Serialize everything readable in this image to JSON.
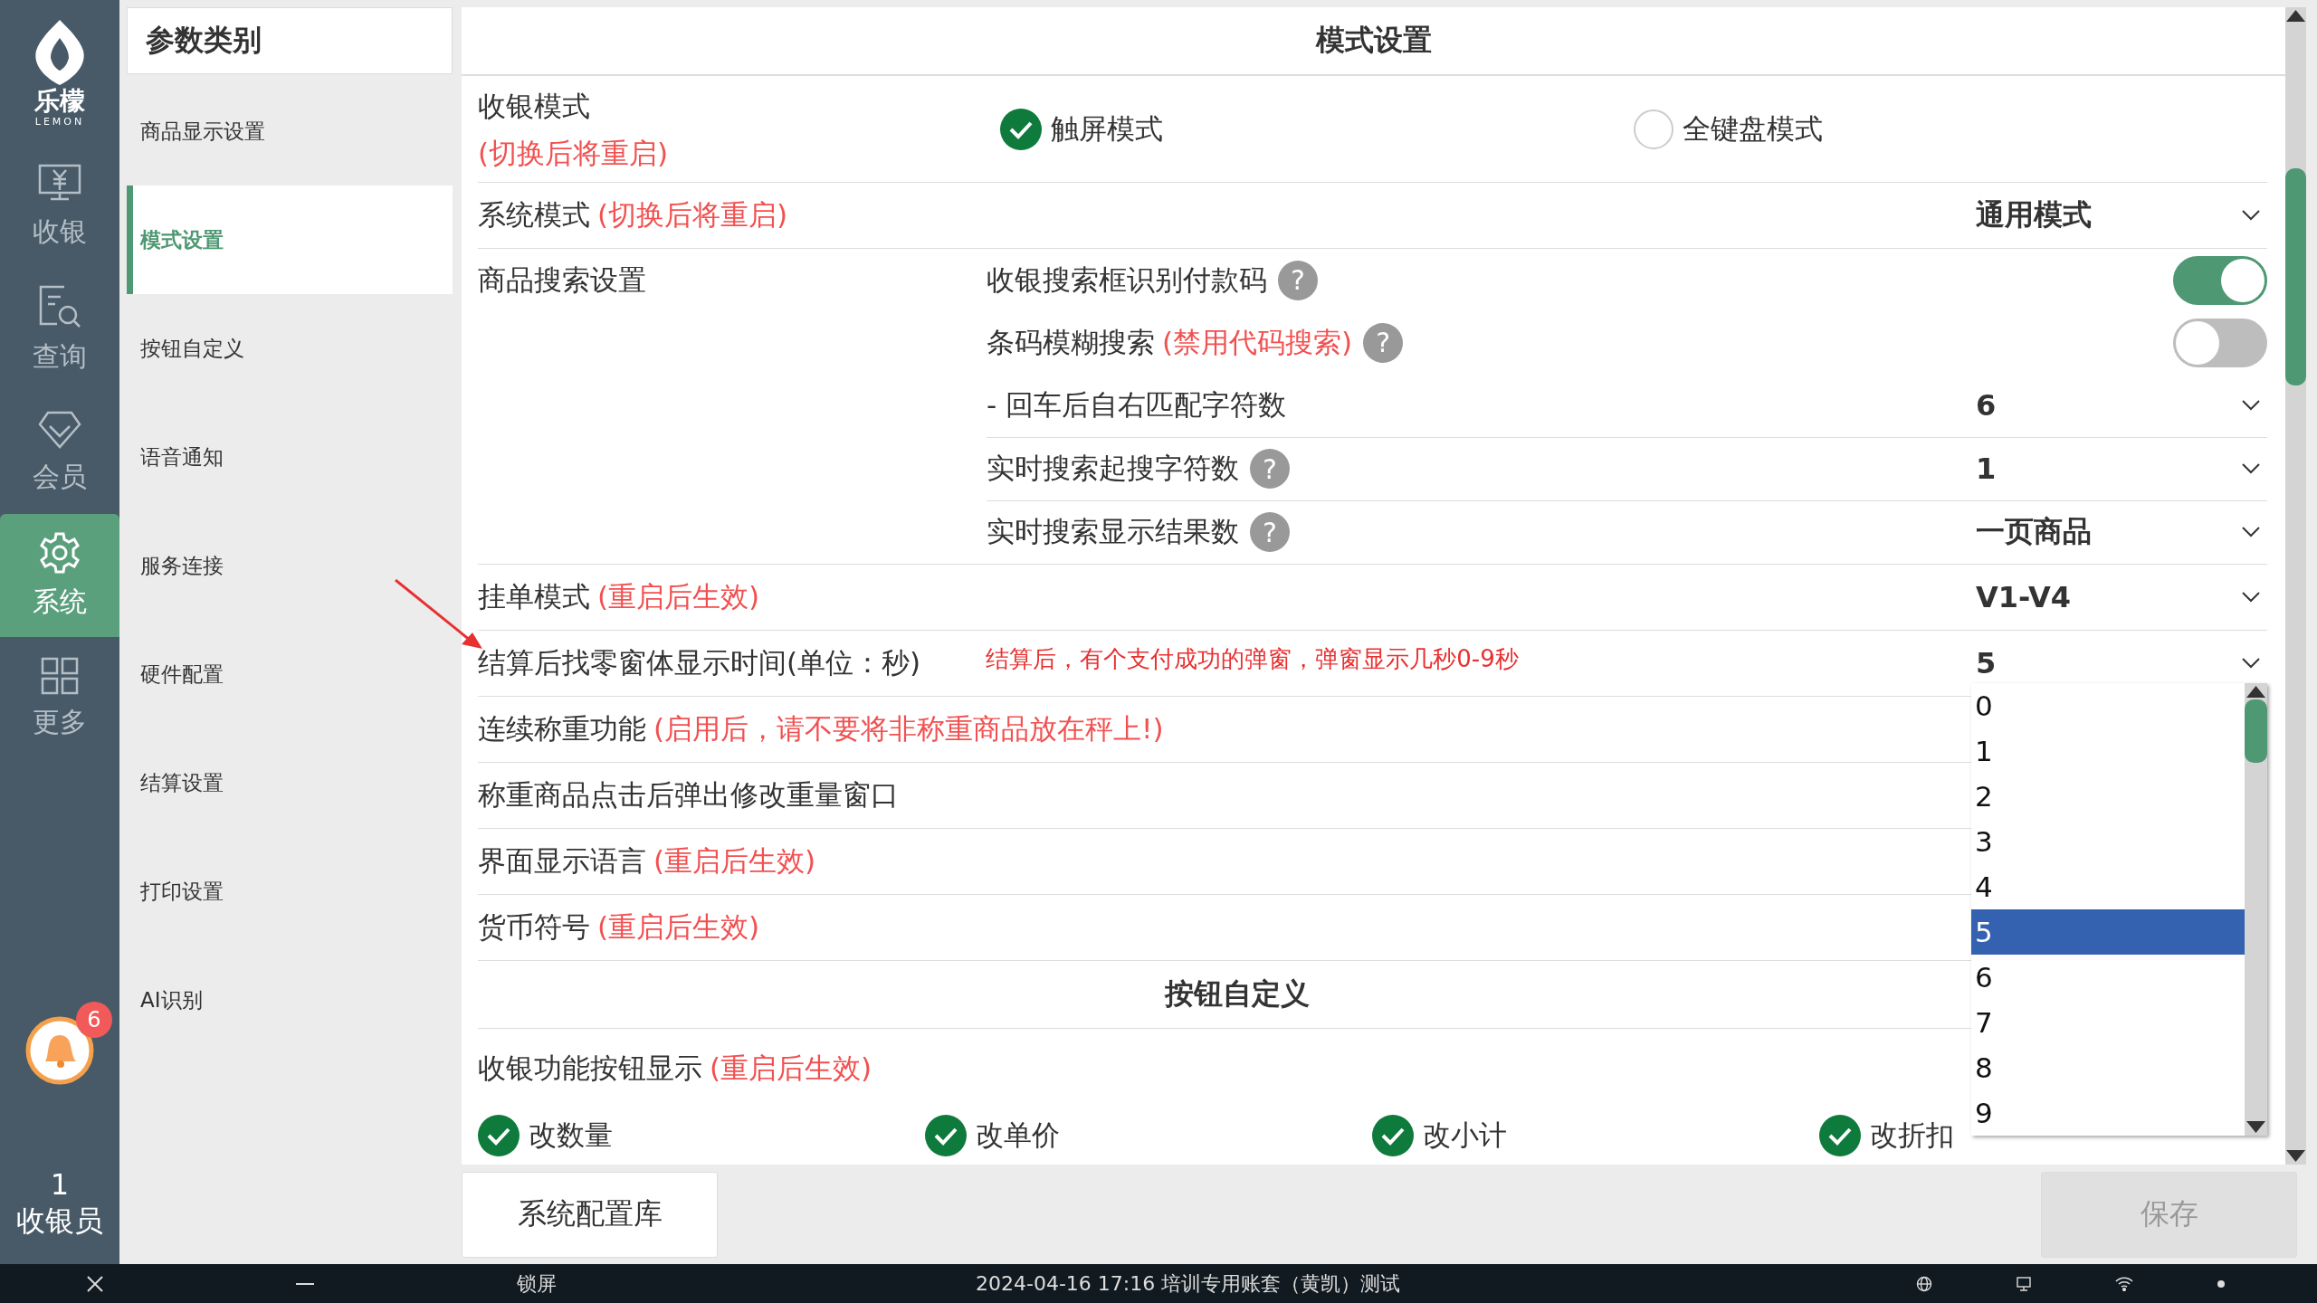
{
  "nav": {
    "logo_text": "乐檬",
    "logo_subtext": "LEMON",
    "items": [
      {
        "kind": "register",
        "label": "收银",
        "selected": false
      },
      {
        "kind": "query",
        "label": "查询",
        "selected": false
      },
      {
        "kind": "member",
        "label": "会员",
        "selected": false
      },
      {
        "kind": "system",
        "label": "系统",
        "selected": true
      },
      {
        "kind": "more",
        "label": "更多",
        "selected": false
      }
    ],
    "notification_count": "6",
    "user_number": "1",
    "user_role": "收银员"
  },
  "categories": {
    "title": "参数类别",
    "items": [
      {
        "label": "商品显示设置",
        "selected": false
      },
      {
        "label": "模式设置",
        "selected": true
      },
      {
        "label": "按钮自定义",
        "selected": false
      },
      {
        "label": "语音通知",
        "selected": false
      },
      {
        "label": "服务连接",
        "selected": false
      },
      {
        "label": "硬件配置",
        "selected": false
      },
      {
        "label": "结算设置",
        "selected": false
      },
      {
        "label": "打印设置",
        "selected": false
      },
      {
        "label": "AI识别",
        "selected": false
      }
    ]
  },
  "panel": {
    "title": "模式设置",
    "rows": [
      {
        "kind": "radio",
        "label": "收银模式",
        "note": "(切换后将重启)",
        "options": [
          {
            "label": "触屏模式",
            "selected": true
          },
          {
            "label": "全键盘模式",
            "selected": false
          }
        ]
      },
      {
        "kind": "select",
        "label": "系统模式",
        "note": "(切换后将重启)",
        "value": "通用模式"
      },
      {
        "kind": "group",
        "label": "商品搜索设置",
        "items": [
          {
            "kind": "toggle",
            "label": "收银搜索框识别付款码",
            "help": "?",
            "on": true
          },
          {
            "kind": "toggle",
            "label": "条码模糊搜索",
            "note": "(禁用代码搜索)",
            "help": "?",
            "on": false
          },
          {
            "kind": "select",
            "label": "- 回车后自右匹配字符数",
            "value": "6"
          },
          {
            "kind": "select",
            "label": "实时搜索起搜字符数",
            "help": "?",
            "value": "1"
          },
          {
            "kind": "select",
            "label": "实时搜索显示结果数",
            "help": "?",
            "value": "一页商品"
          }
        ]
      },
      {
        "kind": "select",
        "label": "挂单模式",
        "note": "(重启后生效)",
        "value": "V1-V4"
      },
      {
        "kind": "select",
        "label": "结算后找零窗体显示时间(单位：秒)",
        "annotation": "结算后，有个支付成功的弹窗，弹窗显示几秒0-9秒",
        "value": "5",
        "options": [
          {
            "label": "0",
            "selected": false
          },
          {
            "label": "1",
            "selected": false
          },
          {
            "label": "2",
            "selected": false
          },
          {
            "label": "3",
            "selected": false
          },
          {
            "label": "4",
            "selected": false
          },
          {
            "label": "5",
            "selected": true
          },
          {
            "label": "6",
            "selected": false
          },
          {
            "label": "7",
            "selected": false
          },
          {
            "label": "8",
            "selected": false
          },
          {
            "label": "9",
            "selected": false
          }
        ]
      },
      {
        "kind": "plain",
        "label": "连续称重功能",
        "note": "(启用后，请不要将非称重商品放在秤上!)"
      },
      {
        "kind": "plain",
        "label": "称重商品点击后弹出修改重量窗口"
      },
      {
        "kind": "plain",
        "label": "界面显示语言",
        "note": "(重启后生效)"
      },
      {
        "kind": "plain",
        "label": "货币符号",
        "note": "(重启后生效)"
      },
      {
        "kind": "section",
        "label": "按钮自定义"
      },
      {
        "kind": "checks",
        "label": "收银功能按钮显示",
        "note": "(重启后生效)",
        "options": [
          {
            "label": "改数量",
            "checked": true
          },
          {
            "label": "改单价",
            "checked": true
          },
          {
            "label": "改小计",
            "checked": true
          },
          {
            "label": "改折扣",
            "checked": true
          }
        ]
      }
    ]
  },
  "footer": {
    "library_button": "系统配置库",
    "save_button": {
      "label": "保存",
      "disabled": true
    }
  },
  "taskbar": {
    "lock_label": "锁屏",
    "status": "2024-04-16 17:16 培训专用账套（黄凯）测试"
  }
}
